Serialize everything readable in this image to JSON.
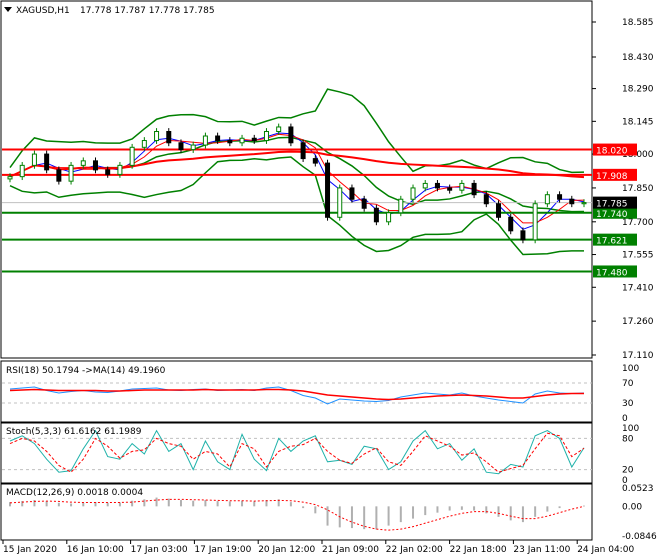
{
  "header": {
    "symbol": "XAGUSD,H1",
    "ohlc": "17.778 17.787 17.778 17.785"
  },
  "colors": {
    "bull": "#008000",
    "bear": "#000000",
    "band": "#008000",
    "red": "#ff0000",
    "blue": "#0000ff",
    "rsi": "#1e90ff",
    "stoch": "#20b2aa"
  },
  "chart_data": [
    {
      "type": "candlestick",
      "title": "XAGUSD,H1",
      "ylim": [
        17.11,
        18.62
      ],
      "yticks": [
        "18.585",
        "18.430",
        "18.290",
        "18.145",
        "18.000",
        "17.850",
        "17.700",
        "17.555",
        "17.410",
        "17.260",
        "17.110"
      ],
      "current_price": "17.785",
      "levels": [
        {
          "value": "18.020",
          "color": "#ff0000"
        },
        {
          "value": "17.908",
          "color": "#ff0000"
        },
        {
          "value": "17.740",
          "color": "#008000"
        },
        {
          "value": "17.621",
          "color": "#008000"
        },
        {
          "value": "17.480",
          "color": "#008000"
        }
      ],
      "closes": [
        17.9,
        17.95,
        18.0,
        17.93,
        17.88,
        17.95,
        17.97,
        17.93,
        17.91,
        17.95,
        18.03,
        18.06,
        18.1,
        18.05,
        18.02,
        18.04,
        18.08,
        18.06,
        18.05,
        18.07,
        18.06,
        18.1,
        18.12,
        18.05,
        17.98,
        17.96,
        17.72,
        17.85,
        17.8,
        17.76,
        17.7,
        17.74,
        17.8,
        17.85,
        17.87,
        17.85,
        17.84,
        17.87,
        17.82,
        17.78,
        17.72,
        17.66,
        17.62,
        17.78,
        17.82,
        17.8,
        17.78,
        17.785
      ],
      "xlabels": [
        "15 Jan 2020",
        "16 Jan 10:00",
        "17 Jan 03:00",
        "17 Jan 19:00",
        "20 Jan 12:00",
        "21 Jan 09:00",
        "22 Jan 02:00",
        "22 Jan 18:00",
        "23 Jan 11:00",
        "24 Jan 04:00"
      ]
    },
    {
      "type": "line",
      "title": "RSI(18) 50.1794  ->MA(14) 49.1960",
      "ylim": [
        0,
        100
      ],
      "yticks": [
        "100",
        "70",
        "30",
        "0"
      ],
      "rsi": [
        58,
        60,
        62,
        55,
        50,
        53,
        55,
        52,
        51,
        54,
        58,
        59,
        60,
        56,
        55,
        57,
        58,
        55,
        56,
        57,
        55,
        60,
        62,
        55,
        45,
        40,
        28,
        38,
        36,
        34,
        33,
        35,
        42,
        46,
        50,
        48,
        46,
        50,
        44,
        40,
        36,
        33,
        30,
        48,
        54,
        50,
        49,
        50
      ],
      "ma": [
        55,
        56,
        57,
        56,
        55,
        55,
        55,
        55,
        54,
        54,
        55,
        56,
        56,
        56,
        56,
        56,
        57,
        56,
        56,
        56,
        56,
        57,
        57,
        56,
        54,
        50,
        46,
        44,
        42,
        40,
        38,
        37,
        38,
        40,
        42,
        44,
        45,
        46,
        45,
        44,
        42,
        40,
        40,
        43,
        46,
        48,
        49,
        49
      ]
    },
    {
      "type": "line",
      "title": "Stoch(5,3,3) 61.6162 61.1989",
      "ylim": [
        0,
        100
      ],
      "yticks": [
        "100",
        "80",
        "20",
        "0"
      ],
      "k": [
        75,
        85,
        70,
        40,
        15,
        18,
        60,
        95,
        45,
        40,
        70,
        50,
        95,
        55,
        70,
        20,
        75,
        35,
        20,
        88,
        40,
        18,
        80,
        55,
        75,
        85,
        35,
        38,
        30,
        65,
        60,
        20,
        35,
        75,
        95,
        60,
        70,
        38,
        60,
        15,
        12,
        30,
        25,
        85,
        95,
        80,
        25,
        62
      ],
      "d": [
        70,
        80,
        75,
        55,
        28,
        15,
        40,
        80,
        65,
        42,
        55,
        58,
        80,
        70,
        65,
        40,
        55,
        50,
        25,
        70,
        60,
        25,
        55,
        65,
        68,
        80,
        55,
        38,
        32,
        50,
        62,
        35,
        28,
        55,
        85,
        75,
        65,
        48,
        52,
        35,
        15,
        22,
        28,
        60,
        90,
        85,
        45,
        61
      ]
    },
    {
      "type": "histogram",
      "title": "MACD(12,26,9) 0.0018 0.0004",
      "ylim": [
        -0.0846,
        0.0523
      ],
      "yticks": [
        "0.0523",
        "0.00",
        "-0.0846"
      ],
      "hist": [
        0.012,
        0.015,
        0.018,
        0.015,
        0.01,
        0.008,
        0.01,
        0.012,
        0.01,
        0.011,
        0.016,
        0.02,
        0.025,
        0.022,
        0.018,
        0.016,
        0.018,
        0.015,
        0.014,
        0.016,
        0.014,
        0.018,
        0.02,
        0.012,
        -0.005,
        -0.02,
        -0.055,
        -0.06,
        -0.062,
        -0.065,
        -0.066,
        -0.055,
        -0.045,
        -0.035,
        -0.025,
        -0.018,
        -0.012,
        -0.01,
        -0.012,
        -0.02,
        -0.03,
        -0.04,
        -0.045,
        -0.03,
        -0.015,
        -0.005,
        0.0,
        0.002
      ],
      "signal": [
        0.01,
        0.012,
        0.014,
        0.015,
        0.014,
        0.012,
        0.011,
        0.011,
        0.011,
        0.011,
        0.012,
        0.015,
        0.018,
        0.02,
        0.02,
        0.019,
        0.018,
        0.017,
        0.016,
        0.016,
        0.015,
        0.016,
        0.017,
        0.016,
        0.012,
        0.005,
        -0.01,
        -0.03,
        -0.045,
        -0.057,
        -0.065,
        -0.068,
        -0.065,
        -0.058,
        -0.048,
        -0.038,
        -0.028,
        -0.02,
        -0.015,
        -0.015,
        -0.02,
        -0.028,
        -0.035,
        -0.035,
        -0.028,
        -0.018,
        -0.008,
        0.0
      ]
    }
  ]
}
